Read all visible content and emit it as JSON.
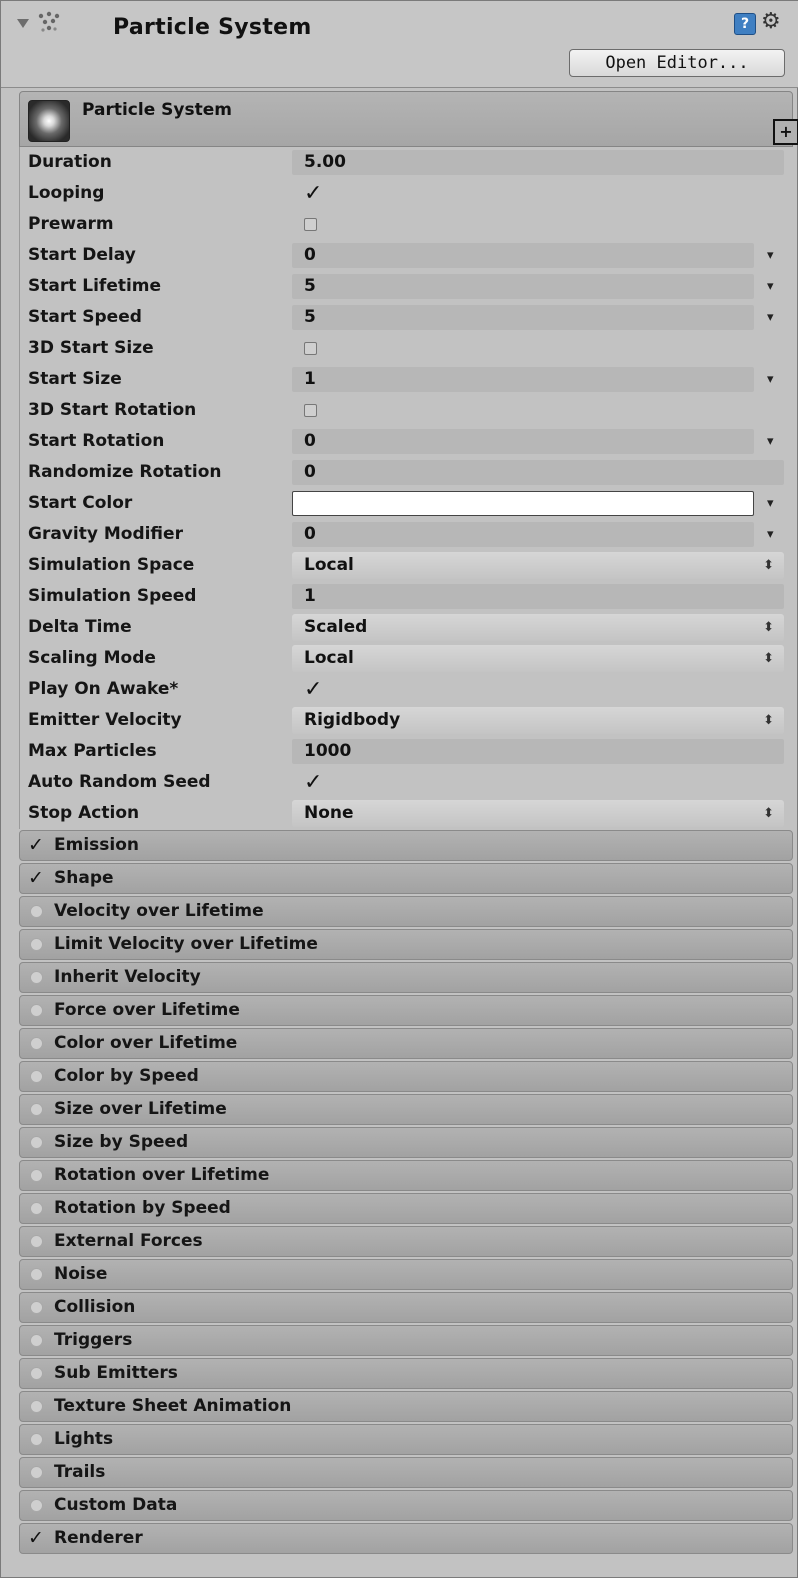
{
  "header": {
    "title": "Particle System",
    "open_editor_label": "Open Editor...",
    "help_glyph": "?",
    "gear_glyph": "⚙"
  },
  "component": {
    "title": "Particle System",
    "plus_glyph": "+"
  },
  "properties": [
    {
      "label": "Duration",
      "kind": "value",
      "value": "5.00",
      "curve": false
    },
    {
      "label": "Looping",
      "kind": "check",
      "checked": true
    },
    {
      "label": "Prewarm",
      "kind": "check",
      "checked": false
    },
    {
      "label": "Start Delay",
      "kind": "value",
      "value": "0",
      "curve": true
    },
    {
      "label": "Start Lifetime",
      "kind": "value",
      "value": "5",
      "curve": true
    },
    {
      "label": "Start Speed",
      "kind": "value",
      "value": "5",
      "curve": true
    },
    {
      "label": "3D Start Size",
      "kind": "check",
      "checked": false
    },
    {
      "label": "Start Size",
      "kind": "value",
      "value": "1",
      "curve": true
    },
    {
      "label": "3D Start Rotation",
      "kind": "check",
      "checked": false
    },
    {
      "label": "Start Rotation",
      "kind": "value",
      "value": "0",
      "curve": true
    },
    {
      "label": "Randomize Rotation",
      "kind": "value",
      "value": "0",
      "curve": false
    },
    {
      "label": "Start Color",
      "kind": "color",
      "value": "#ffffff",
      "curve": true
    },
    {
      "label": "Gravity Modifier",
      "kind": "value",
      "value": "0",
      "curve": true
    },
    {
      "label": "Simulation Space",
      "kind": "popup",
      "value": "Local"
    },
    {
      "label": "Simulation Speed",
      "kind": "value",
      "value": "1",
      "curve": false
    },
    {
      "label": "Delta Time",
      "kind": "popup",
      "value": "Scaled"
    },
    {
      "label": "Scaling Mode",
      "kind": "popup",
      "value": "Local"
    },
    {
      "label": "Play On Awake*",
      "kind": "check",
      "checked": true
    },
    {
      "label": "Emitter Velocity",
      "kind": "popup",
      "value": "Rigidbody"
    },
    {
      "label": "Max Particles",
      "kind": "value",
      "value": "1000",
      "curve": false
    },
    {
      "label": "Auto Random Seed",
      "kind": "check",
      "checked": true
    },
    {
      "label": "Stop Action",
      "kind": "popup",
      "value": "None"
    }
  ],
  "modules": [
    {
      "label": "Emission",
      "enabled": true
    },
    {
      "label": "Shape",
      "enabled": true
    },
    {
      "label": "Velocity over Lifetime",
      "enabled": false
    },
    {
      "label": "Limit Velocity over Lifetime",
      "enabled": false
    },
    {
      "label": "Inherit Velocity",
      "enabled": false
    },
    {
      "label": "Force over Lifetime",
      "enabled": false
    },
    {
      "label": "Color over Lifetime",
      "enabled": false
    },
    {
      "label": "Color by Speed",
      "enabled": false
    },
    {
      "label": "Size over Lifetime",
      "enabled": false
    },
    {
      "label": "Size by Speed",
      "enabled": false
    },
    {
      "label": "Rotation over Lifetime",
      "enabled": false
    },
    {
      "label": "Rotation by Speed",
      "enabled": false
    },
    {
      "label": "External Forces",
      "enabled": false
    },
    {
      "label": "Noise",
      "enabled": false
    },
    {
      "label": "Collision",
      "enabled": false
    },
    {
      "label": "Triggers",
      "enabled": false
    },
    {
      "label": "Sub Emitters",
      "enabled": false
    },
    {
      "label": "Texture Sheet Animation",
      "enabled": false
    },
    {
      "label": "Lights",
      "enabled": false
    },
    {
      "label": "Trails",
      "enabled": false
    },
    {
      "label": "Custom Data",
      "enabled": false
    },
    {
      "label": "Renderer",
      "enabled": true
    }
  ],
  "glyphs": {
    "check": "✓",
    "curve_arrow": "▾",
    "popup_arrows": "⬍"
  },
  "colors": {
    "panel_bg": "#c2c2c2",
    "field_bg": "#b7b7b7",
    "module_bg": "#a8a8a8",
    "help_blue": "#3f7fc2"
  }
}
